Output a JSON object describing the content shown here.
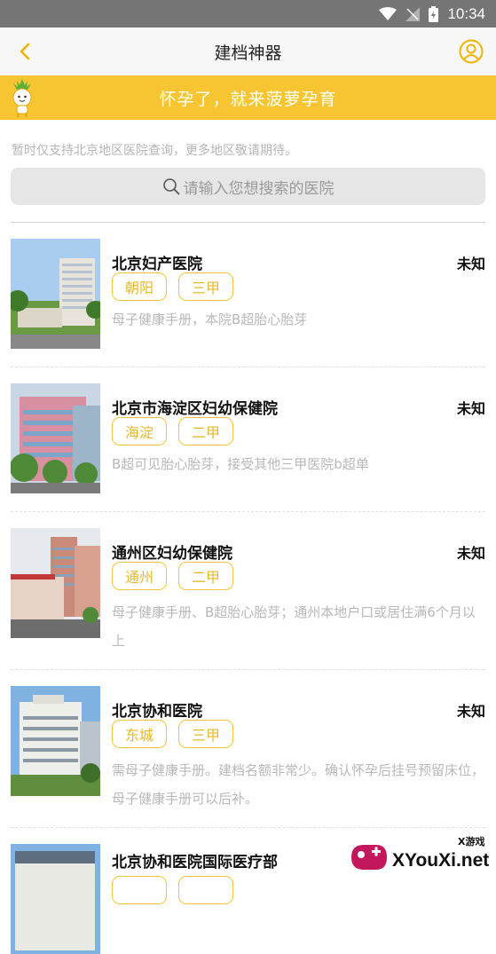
{
  "statusbar": {
    "time": "10:34"
  },
  "navbar": {
    "title": "建档神器"
  },
  "banner": {
    "slogan": "怀孕了，就来菠萝孕育"
  },
  "notice": "暂时仅支持北京地区医院查询，更多地区敬请期待。",
  "search": {
    "placeholder": "请输入您想搜索的医院"
  },
  "hospitals": [
    {
      "name": "北京妇产医院",
      "status": "未知",
      "tags": [
        "朝阳",
        "三甲"
      ],
      "desc": "母子健康手册，本院B超胎心胎芽"
    },
    {
      "name": "北京市海淀区妇幼保健院",
      "status": "未知",
      "tags": [
        "海淀",
        "二甲"
      ],
      "desc": "B超可见胎心胎芽，接受其他三甲医院b超单"
    },
    {
      "name": "通州区妇幼保健院",
      "status": "未知",
      "tags": [
        "通州",
        "二甲"
      ],
      "desc": "母子健康手册、B超胎心胎芽；通州本地户口或居住满6个月以上"
    },
    {
      "name": "北京协和医院",
      "status": "未知",
      "tags": [
        "东城",
        "三甲"
      ],
      "desc": "需母子健康手册。建档名额非常少。确认怀孕后挂号预留床位，母子健康手册可以后补。"
    },
    {
      "name": "北京协和医院国际医疗部",
      "status": "",
      "tags": [
        "",
        ""
      ],
      "desc": ""
    }
  ],
  "watermark": {
    "brand": "XYouXi.net",
    "sub": "X游戏"
  },
  "icons": {
    "back": "chevron-left-icon",
    "user": "user-icon",
    "search": "search-icon",
    "wifi": "wifi-icon",
    "signal": "signal-icon",
    "battery": "battery-icon"
  },
  "colors": {
    "accent": "#f7c531",
    "status_bar": "#757575",
    "tag_border": "#f3c53c"
  }
}
